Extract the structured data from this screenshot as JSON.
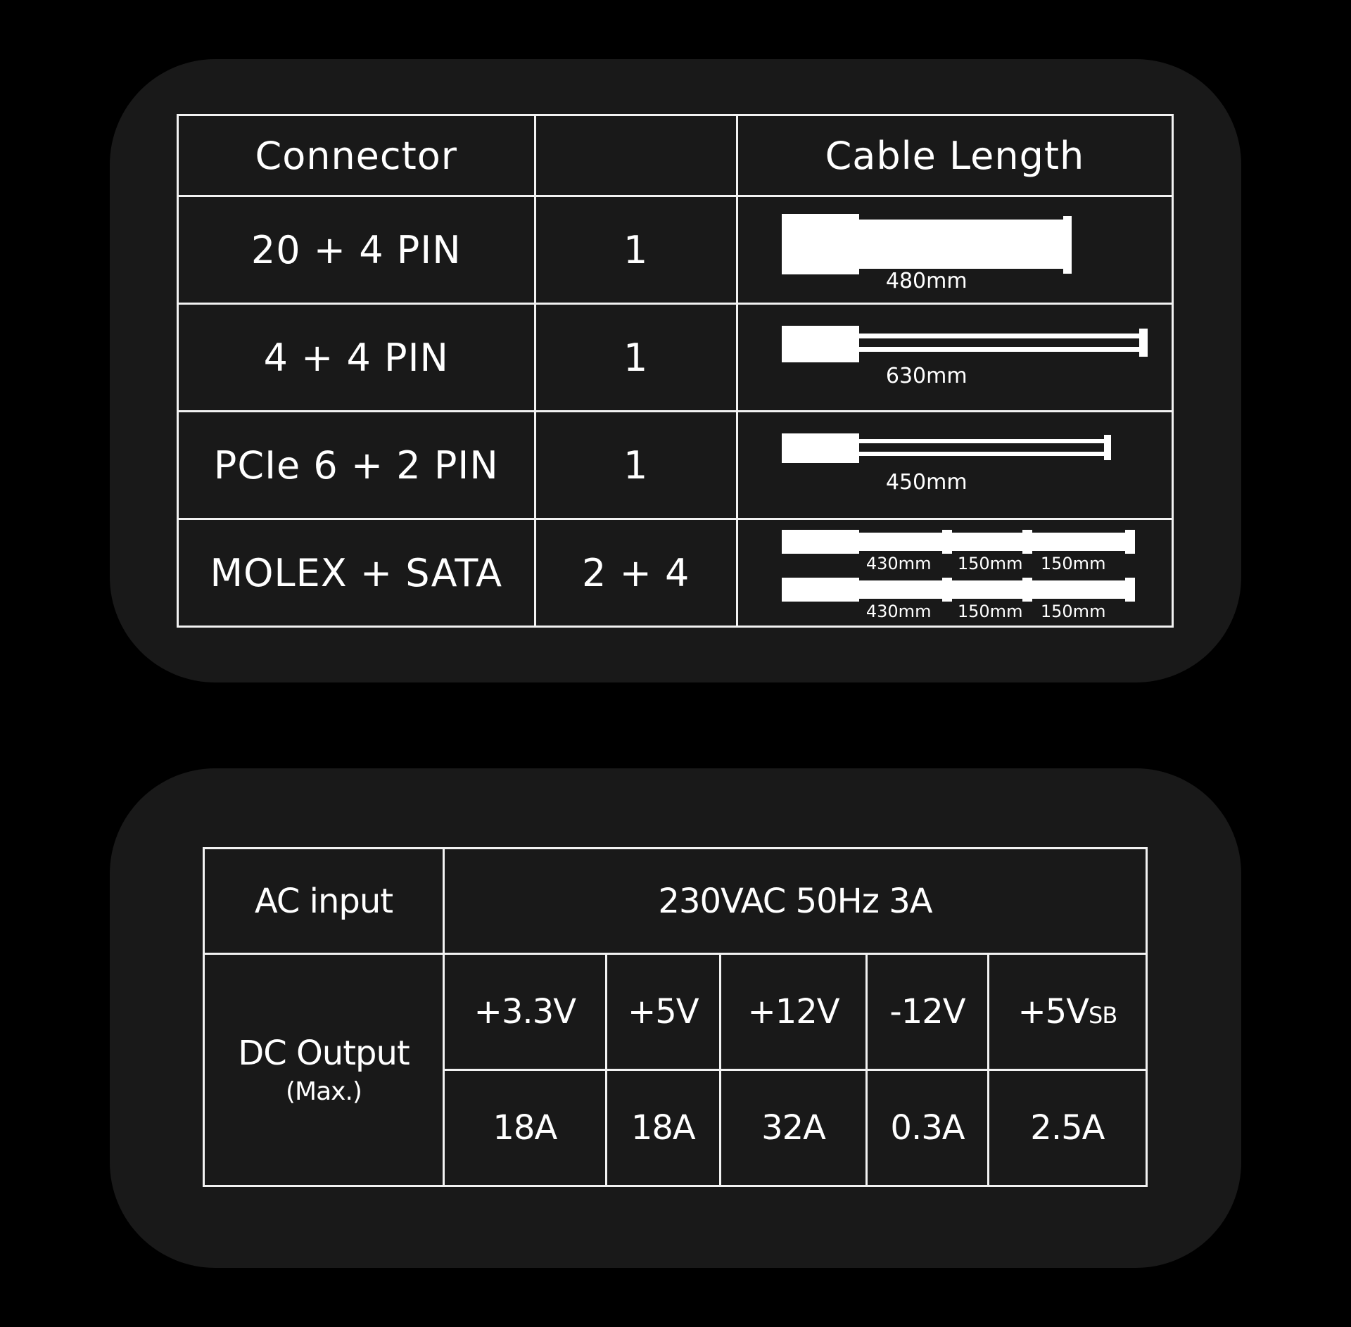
{
  "connector_table": {
    "headers": [
      "Connector",
      "",
      "Cable Length"
    ],
    "rows": [
      {
        "connector": "20 + 4 PIN",
        "count": "1",
        "lengths": [
          "480mm"
        ]
      },
      {
        "connector": "4 + 4 PIN",
        "count": "1",
        "lengths": [
          "630mm"
        ]
      },
      {
        "connector": "PCIe 6 + 2 PIN",
        "count": "1",
        "lengths": [
          "450mm"
        ]
      },
      {
        "connector": "MOLEX + SATA",
        "count": "2 + 4",
        "lengths": [
          "430mm",
          "150mm",
          "150mm"
        ],
        "lengths2": [
          "430mm",
          "150mm",
          "150mm"
        ]
      }
    ]
  },
  "power_table": {
    "ac_label": "AC input",
    "ac_value": "230VAC 50Hz 3A",
    "dc_label": "DC Output",
    "dc_sublabel": "(Max.)",
    "rails": [
      {
        "voltage": "+3.3V",
        "sub": "",
        "current": "18A"
      },
      {
        "voltage": "+5V",
        "sub": "",
        "current": "18A"
      },
      {
        "voltage": "+12V",
        "sub": "",
        "current": "32A"
      },
      {
        "voltage": "-12V",
        "sub": "",
        "current": "0.3A"
      },
      {
        "voltage": "+5V",
        "sub": "SB",
        "current": "2.5A"
      }
    ]
  }
}
